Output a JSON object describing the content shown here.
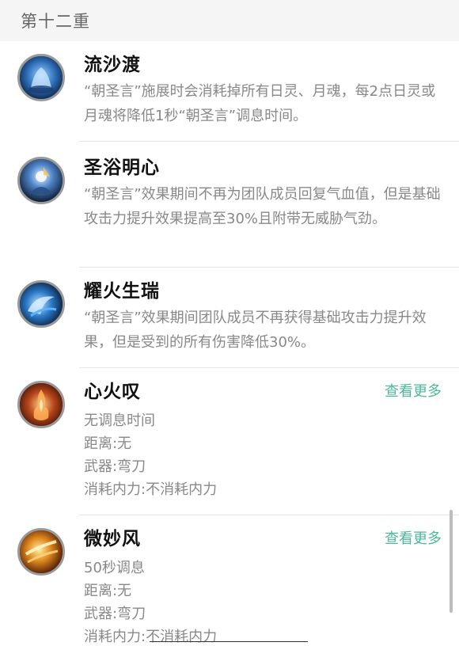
{
  "section": {
    "title": "第十二重"
  },
  "skills": [
    {
      "name": "流沙渡",
      "icon": "sand-ferry-icon",
      "description": "“朝圣言”施展时会消耗掉所有日灵、月魂，每2点日灵或月魂将降低1秒“朝圣言”调息时间。"
    },
    {
      "name": "圣浴明心",
      "icon": "holy-bath-icon",
      "description": "“朝圣言”效果期间不再为团队成员回复气血值，但是基础攻击力提升效果提高至30%且附带无威胁气劲。"
    },
    {
      "name": "耀火生瑞",
      "icon": "blazing-fire-icon",
      "description": "“朝圣言”效果期间团队成员不再获得基础攻击力提升效果，但是受到的所有伤害降低30%。"
    },
    {
      "name": "心火叹",
      "icon": "heart-fire-icon",
      "more_label": "查看更多",
      "lines": [
        "无调息时间",
        "距离:无",
        "武器:弯刀",
        "消耗内力:不消耗内力"
      ]
    },
    {
      "name": "微妙风",
      "icon": "subtle-wind-icon",
      "more_label": "查看更多",
      "lines": [
        "50秒调息",
        "距离:无",
        "武器:弯刀",
        "消耗内力:不消耗内力"
      ]
    }
  ],
  "colors": {
    "accent": "#4db89b",
    "title": "#111111",
    "text": "#888888",
    "header_bg": "#f5f5f5"
  }
}
